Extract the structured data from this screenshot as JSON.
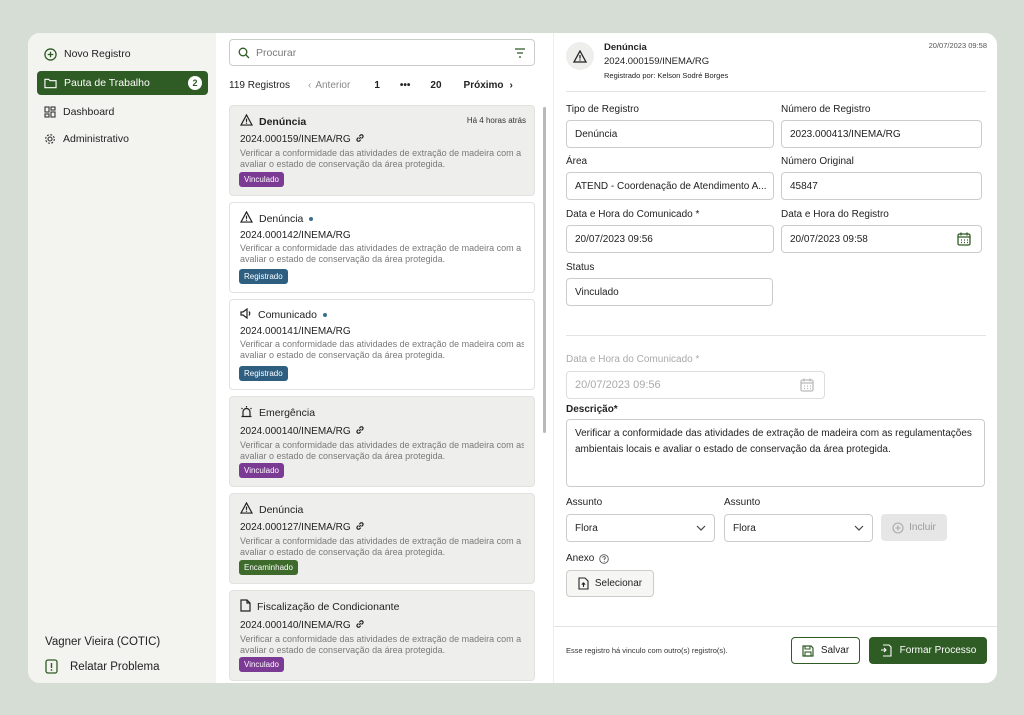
{
  "colors": {
    "accent": "#2f5b24",
    "vinculado": "#7b3a93",
    "registrado": "#2e5f80",
    "encaminhado": "#3e6a2c"
  },
  "sidebar": {
    "items": [
      {
        "label": "Novo Registro",
        "icon": "plus-circle-icon"
      },
      {
        "label": "Pauta de Trabalho",
        "icon": "folder-icon",
        "badge": "2"
      },
      {
        "label": "Dashboard",
        "icon": "dashboard-icon"
      },
      {
        "label": "Administrativo",
        "icon": "gear-icon"
      }
    ],
    "user": "Vagner Vieira (COTIC)",
    "report": "Relatar Problema"
  },
  "list": {
    "search_placeholder": "Procurar",
    "count": "119 Registros",
    "prev": "Anterior",
    "pages": [
      "1",
      "•••",
      "20"
    ],
    "next": "Próximo",
    "cards": [
      {
        "type": "Denúncia",
        "icon": "warning-icon",
        "time": "Há 4 horas atrás",
        "num": "2024.000159/INEMA/RG",
        "link": true,
        "desc1": "Verificar a conformidade das atividades de extração de madeira com a",
        "desc2": "avaliar o estado de conservação da área protegida.",
        "tag": "Vinculado",
        "tagColor": "#7b3a93",
        "grey": true,
        "bold": true,
        "dot": false
      },
      {
        "type": "Denúncia",
        "icon": "warning-icon",
        "time": "",
        "num": "2024.000142/INEMA/RG",
        "link": false,
        "desc1": "Verificar a conformidade das atividades de extração de madeira com a",
        "desc2": "avaliar o estado de conservação da área protegida.",
        "tag": "Registrado",
        "tagColor": "#2e5f80",
        "grey": false,
        "bold": false,
        "dot": true
      },
      {
        "type": "Comunicado",
        "icon": "megaphone-icon",
        "time": "",
        "num": "2024.000141/INEMA/RG",
        "link": false,
        "desc1": "Verificar a conformidade das atividades de extração de madeira com as",
        "desc2": "avaliar o estado de conservação da área protegida.",
        "tag": "Registrado",
        "tagColor": "#2e5f80",
        "grey": false,
        "bold": false,
        "dot": true
      },
      {
        "type": "Emergência",
        "icon": "siren-icon",
        "time": "",
        "num": "2024.000140/INEMA/RG",
        "link": true,
        "desc1": "Verificar a conformidade das atividades de extração de madeira com as",
        "desc2": "avaliar o estado de conservação da área protegida.",
        "tag": "Vinculado",
        "tagColor": "#7b3a93",
        "grey": true,
        "bold": false,
        "dot": false
      },
      {
        "type": "Denúncia",
        "icon": "warning-icon",
        "time": "",
        "num": "2024.000127/INEMA/RG",
        "link": true,
        "desc1": "Verificar a conformidade das atividades de extração de madeira com a",
        "desc2": "avaliar o estado de conservação da área protegida.",
        "tag": "Encaminhado",
        "tagColor": "#3e6a2c",
        "grey": true,
        "bold": false,
        "dot": false
      },
      {
        "type": "Fiscalização de Condicionante",
        "icon": "document-icon",
        "time": "",
        "num": "2024.000140/INEMA/RG",
        "link": true,
        "desc1": "Verificar a conformidade das atividades de extração de madeira com a",
        "desc2": "avaliar o estado de conservação da área protegida.",
        "tag": "Vinculado",
        "tagColor": "#7b3a93",
        "grey": true,
        "bold": false,
        "dot": false
      }
    ]
  },
  "detail": {
    "title": "Denúncia",
    "num": "2024.000159/INEMA/RG",
    "by": "Registrado por: Kelson Sodré Borges",
    "date": "20/07/2023 09:58",
    "tipo_label": "Tipo de Registro",
    "tipo_value": "Denúncia",
    "numreg_label": "Número de Registro",
    "numreg_value": "2023.000413/INEMA/RG",
    "area_label": "Área",
    "area_value": "ATEND - Coordenação de Atendimento A...",
    "numorig_label": "Número Original",
    "numorig_value": "45847",
    "dtcom_label": "Data e Hora do Comunicado *",
    "dtcom_value": "20/07/2023 09:56",
    "dtreg_label": "Data e Hora do Registro",
    "dtreg_value": "20/07/2023 09:58",
    "status_label": "Status",
    "status_value": "Vinculado",
    "dtcom2_label": "Data e Hora do Comunicado *",
    "dtcom2_value": "20/07/2023 09:56",
    "desc_label": "Descrição*",
    "desc_value": "Verificar a conformidade das atividades de extração de madeira com as regulamentações ambientais locais e avaliar o estado de conservação da área protegida.",
    "assunto1_label": "Assunto",
    "assunto1_value": "Flora",
    "assunto2_label": "Assunto",
    "assunto2_value": "Flora",
    "incluir": "Incluir",
    "anexo_label": "Anexo",
    "selecionar": "Selecionar",
    "footer_note": "Esse registro há vinculo com outro(s) registro(s).",
    "salvar": "Salvar",
    "formar": "Formar Processo"
  }
}
